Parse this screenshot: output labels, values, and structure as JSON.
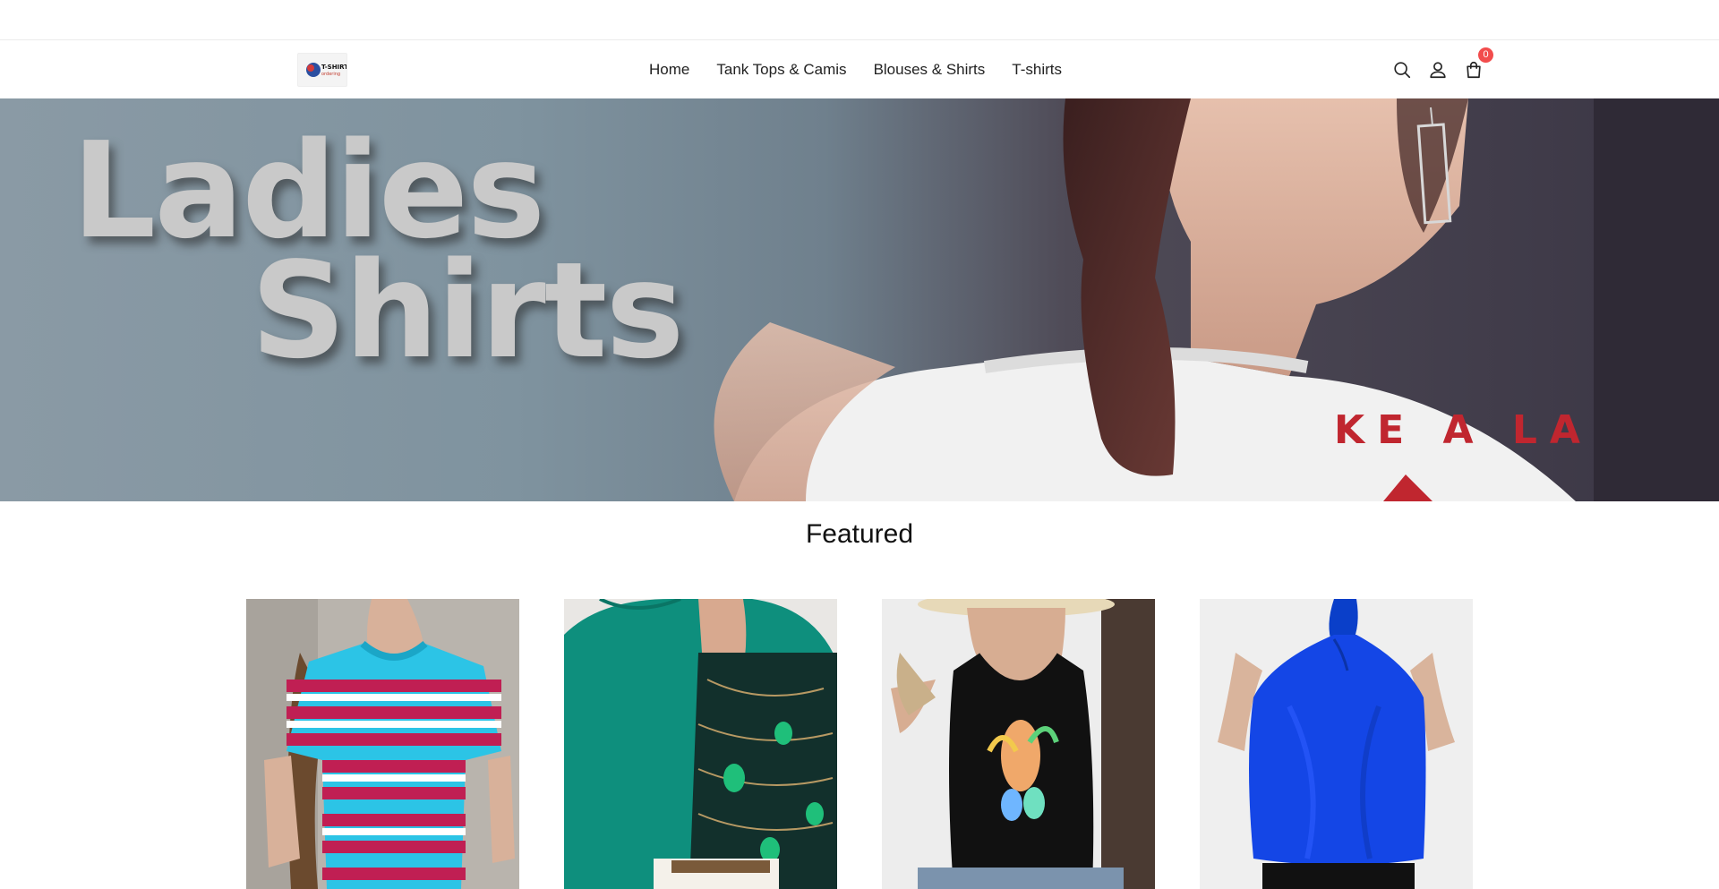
{
  "store": {
    "logo_alt": "T-SHIRT",
    "logo_text_top": "T-SHIRT",
    "logo_text_bottom": "ordering"
  },
  "nav": {
    "items": [
      {
        "label": "Home"
      },
      {
        "label": "Tank Tops & Camis"
      },
      {
        "label": "Blouses & Shirts"
      },
      {
        "label": "T-shirts"
      }
    ]
  },
  "header_icons": {
    "search": "search-icon",
    "account": "account-icon",
    "cart": "cart-icon",
    "cart_count": "0"
  },
  "hero": {
    "line1": "Ladies",
    "line2": "Shirts",
    "shirt_print": "KE A LA"
  },
  "featured": {
    "title": "Featured",
    "products": [
      {
        "image": "striped-tshirt"
      },
      {
        "image": "peacock-print-blouse"
      },
      {
        "image": "surf-print-tank-top"
      },
      {
        "image": "blue-halter-top"
      }
    ]
  },
  "colors": {
    "badge": "#f24c4c",
    "text": "#222222"
  }
}
